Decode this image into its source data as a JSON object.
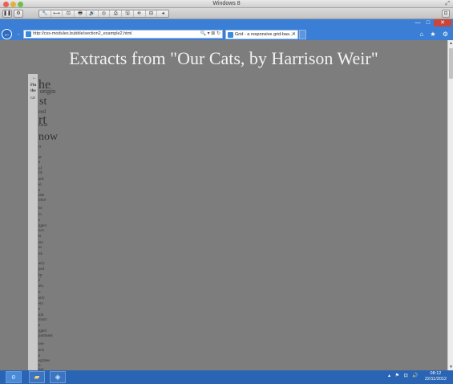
{
  "mac_window": {
    "title": "Windows 8"
  },
  "vm_toolbar": {
    "left_buttons": [
      "❚❚",
      "⚙"
    ],
    "tools": [
      "🔧",
      "⟷",
      "⊡",
      "🖶",
      "🔊",
      "◎",
      "⎙",
      "🖫",
      "⎆",
      "⊟",
      "◂"
    ]
  },
  "ie": {
    "address": "http://css-modules.bubble/section2_example2.html",
    "address_tools": "🔍 ▾ ⊠ ↻",
    "tab_title": "Grid - a responsive grid-bas...",
    "tab_close": "✕",
    "right_icons": "⌂ ★ ⚙"
  },
  "page": {
    "title": "Extracts from \"Our Cats, by Harrison Weir\"",
    "column_fragments": [
      "←",
      "he",
      "Flu",
      "the",
      "origin",
      "cat",
      "st",
      "red",
      "rt",
      "nimal",
      "now",
      "o",
      "at",
      "e",
      "of",
      "ily",
      "ard",
      "el",
      "e",
      "iate",
      "once",
      "ns",
      "in",
      "s",
      "gged",
      "nce",
      "ts",
      "ety",
      "es",
      "nk",
      "arly",
      "ped",
      "ty",
      "e",
      "ats,",
      "n",
      "arly",
      "ety",
      "e",
      "gin",
      "ttract",
      "e",
      "gged",
      "partment",
      "ose",
      "ack",
      "e",
      "egrates",
      "n",
      "her",
      "ms"
    ]
  },
  "taskbar": {
    "tray_icons": "▴ ⚑ ⊡ 🔊",
    "time": "08:12",
    "date": "22/11/2012"
  }
}
